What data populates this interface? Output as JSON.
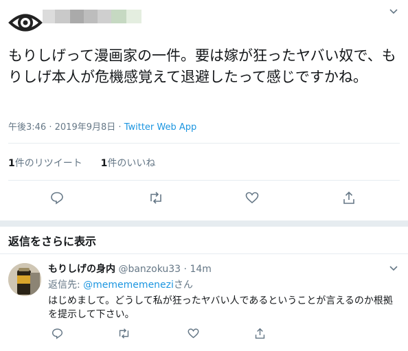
{
  "tweet": {
    "text": "もりしげって漫画家の一件。要は嫁が狂ったヤバい奴で、もりしげ本人が危機感覚えて退避したって感じですかね。",
    "time": "午後3:46",
    "sep": "·",
    "date": "2019年9月8日",
    "app": "Twitter Web App",
    "retweet_count": "1",
    "retweet_label": "件のリツイート",
    "like_count": "1",
    "like_label": "件のいいね"
  },
  "replies_header": "返信をさらに表示",
  "reply": {
    "name": "もりしげの身内",
    "handle": "@banzoku33",
    "sep": "·",
    "time": "14m",
    "to_label": "返信先:",
    "to_handle": "@memememenezi",
    "to_suffix": "さん",
    "text": "はじめまして。どうして私が狂ったヤバい人であるということが言えるのか根拠を提示して下さい。"
  },
  "colors": {
    "accent": "#1b95e0",
    "muted": "#657786",
    "divider": "#e6ecf0"
  }
}
